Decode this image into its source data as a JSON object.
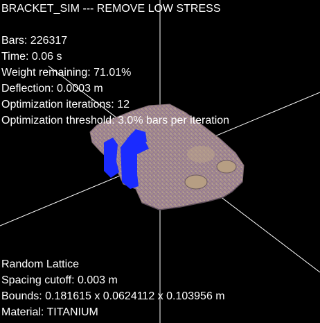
{
  "title": "BRACKET_SIM --- REMOVE LOW STRESS",
  "stats": {
    "bars": "Bars: 226317",
    "time": "Time: 0.06 s",
    "weight": "Weight remaining: 71.01%",
    "deflection": "Deflection: 0.0003 m",
    "iterations": "Optimization iterations: 12",
    "threshold": "Optimization threshold: 3.0% bars per iteration"
  },
  "lattice": {
    "type": "Random Lattice",
    "spacing": "Spacing cutoff: 0.003 m",
    "bounds": "Bounds: 0.181615 x 0.0624112 x 0.103956 m",
    "material": "Material: TITANIUM"
  },
  "colors": {
    "background": "#000000",
    "text": "#ffffff",
    "axis": "#ffffff",
    "mesh_fill": "#a08a85",
    "mesh_accent": "#9a7aa8",
    "mesh_highlight": "#cbb59b",
    "constraint_blue": "#1a2bff"
  },
  "icons": {
    "model": "bracket-mesh",
    "fixed_support": "constraint-marker"
  }
}
